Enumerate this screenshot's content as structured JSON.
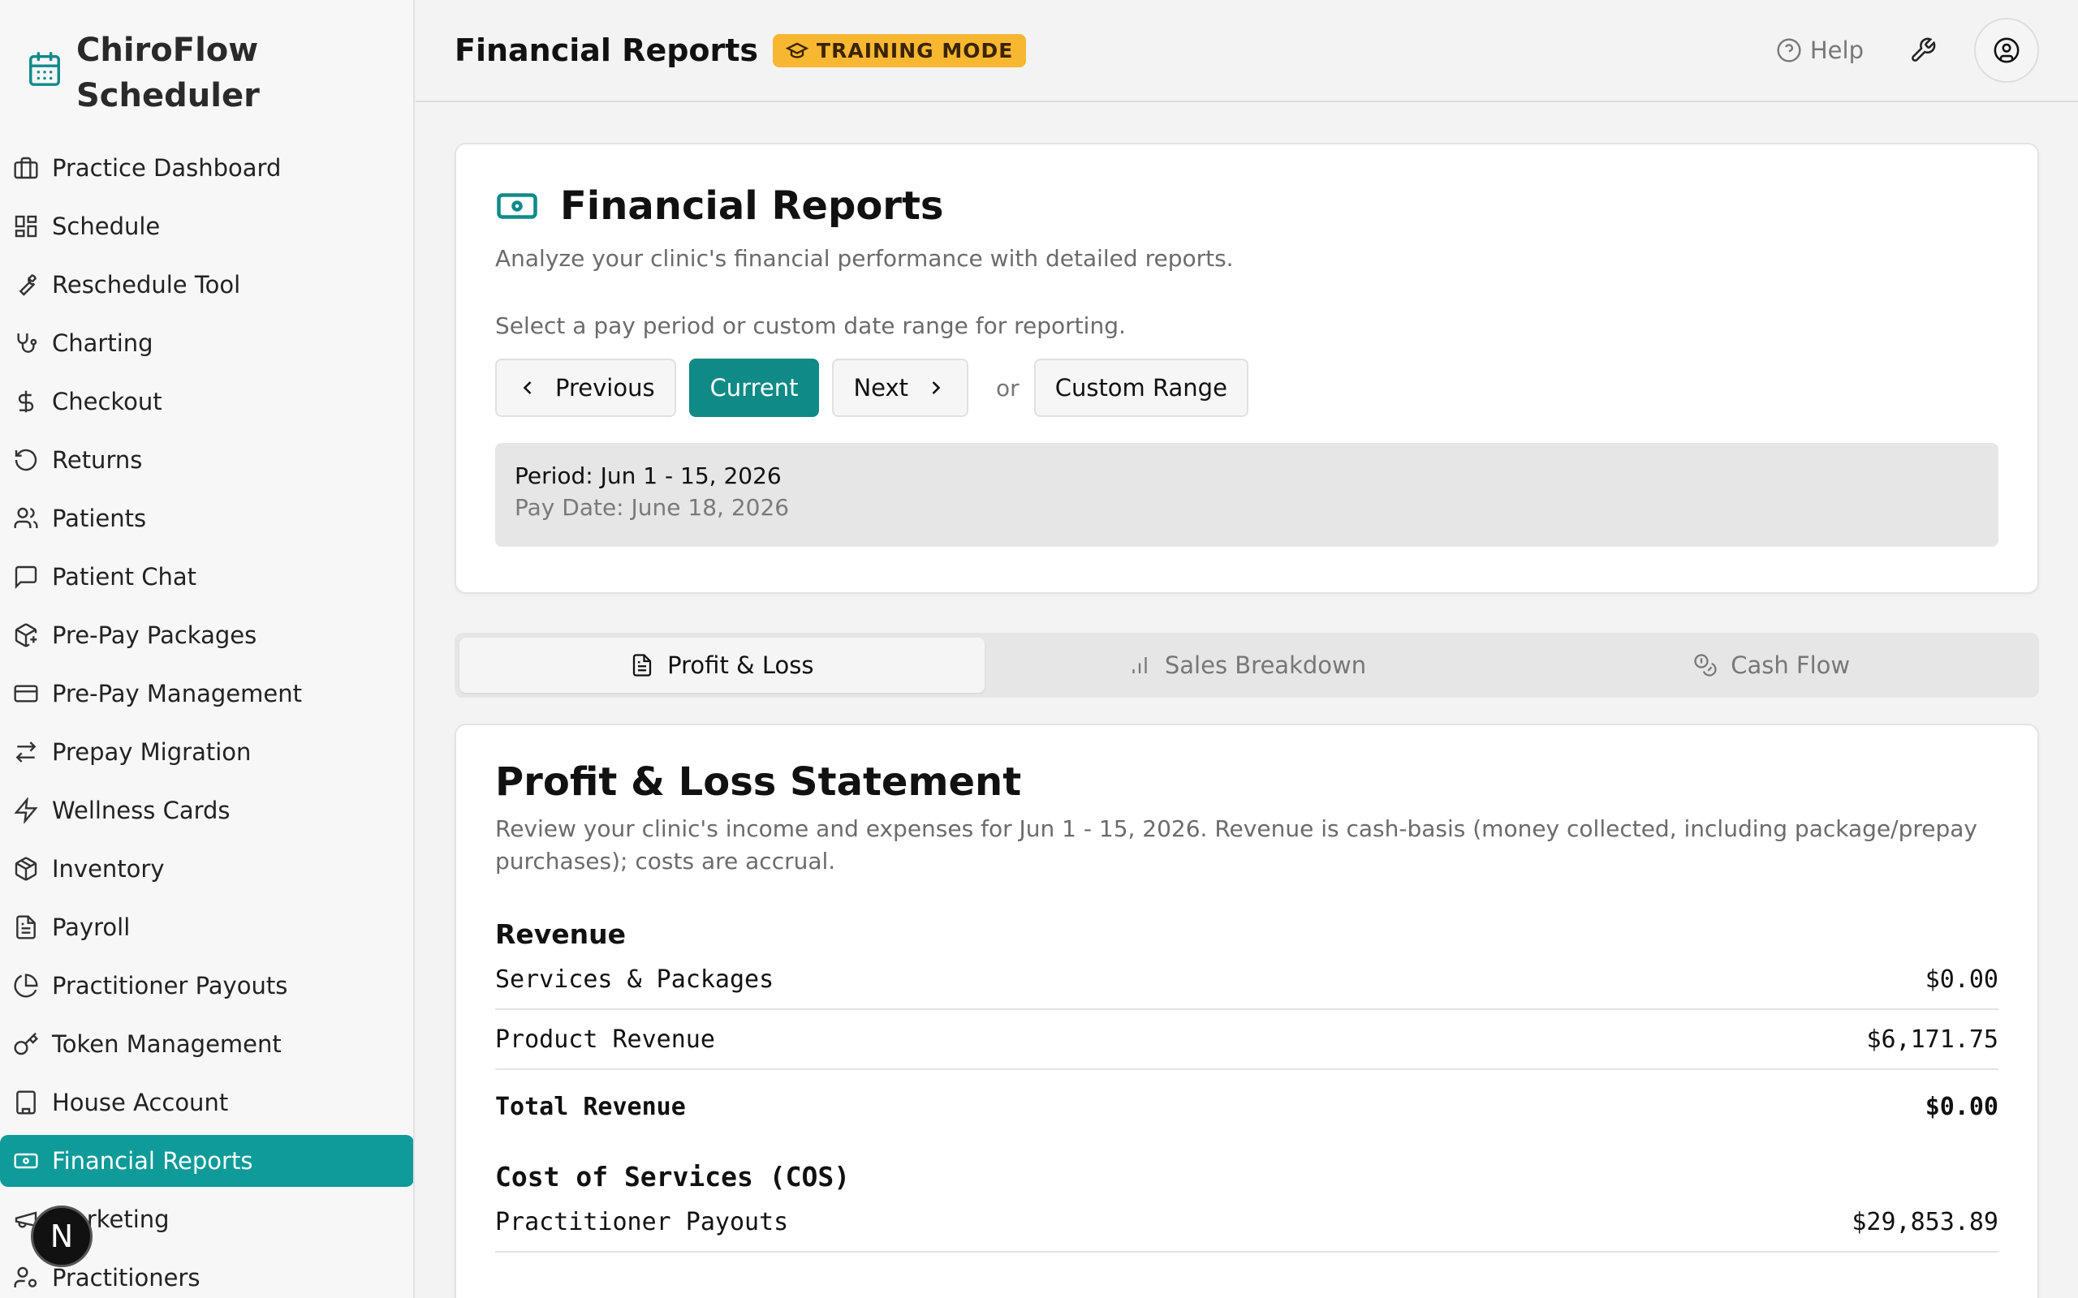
{
  "app": {
    "name": "ChiroFlow Scheduler"
  },
  "sidebar": {
    "items": [
      {
        "label": "Practice Dashboard",
        "icon": "building-icon"
      },
      {
        "label": "Schedule",
        "icon": "grid-icon"
      },
      {
        "label": "Reschedule Tool",
        "icon": "wrench-icon"
      },
      {
        "label": "Charting",
        "icon": "stethoscope-icon"
      },
      {
        "label": "Checkout",
        "icon": "dollar-icon"
      },
      {
        "label": "Returns",
        "icon": "rotate-ccw-icon"
      },
      {
        "label": "Patients",
        "icon": "users-icon"
      },
      {
        "label": "Patient Chat",
        "icon": "message-icon"
      },
      {
        "label": "Pre-Pay Packages",
        "icon": "package-plus-icon"
      },
      {
        "label": "Pre-Pay Management",
        "icon": "credit-card-icon"
      },
      {
        "label": "Prepay Migration",
        "icon": "arrows-icon"
      },
      {
        "label": "Wellness Cards",
        "icon": "zap-icon"
      },
      {
        "label": "Inventory",
        "icon": "box-icon"
      },
      {
        "label": "Payroll",
        "icon": "file-text-icon"
      },
      {
        "label": "Practitioner Payouts",
        "icon": "pie-chart-icon"
      },
      {
        "label": "Token Management",
        "icon": "key-icon"
      },
      {
        "label": "House Account",
        "icon": "bank-icon"
      },
      {
        "label": "Financial Reports",
        "icon": "banknote-icon",
        "active": true
      },
      {
        "label": "Marketing",
        "icon": "megaphone-icon"
      },
      {
        "label": "Practitioners",
        "icon": "user-cog-icon"
      }
    ],
    "floating_badge": "N"
  },
  "header": {
    "title": "Financial Reports",
    "badge": "TRAINING MODE",
    "help": "Help"
  },
  "report": {
    "title": "Financial Reports",
    "subtitle": "Analyze your clinic's financial performance with detailed reports.",
    "hint": "Select a pay period or custom date range for reporting.",
    "prev": "Previous",
    "current": "Current",
    "next": "Next",
    "or": "or",
    "custom": "Custom Range",
    "period": "Period: Jun 1 - 15, 2026",
    "pay_date": "Pay Date: June 18, 2026"
  },
  "tabs": [
    "Profit & Loss",
    "Sales Breakdown",
    "Cash Flow"
  ],
  "pl": {
    "title": "Profit & Loss Statement",
    "desc": "Review your clinic's income and expenses for Jun 1 - 15, 2026. Revenue is cash-basis (money collected, including package/prepay purchases); costs are accrual.",
    "revenue_h": "Revenue",
    "rows": [
      {
        "label": "Services & Packages",
        "value": "$0.00"
      },
      {
        "label": "Product Revenue",
        "value": "$6,171.75"
      }
    ],
    "total": {
      "label": "Total Revenue",
      "value": "$0.00"
    },
    "cos_h": "Cost of Services (COS)",
    "cos_rows": [
      {
        "label": "Practitioner Payouts",
        "value": "$29,853.89"
      }
    ]
  },
  "colors": {
    "accent": "#0f9b99",
    "badge": "#f7b731"
  }
}
